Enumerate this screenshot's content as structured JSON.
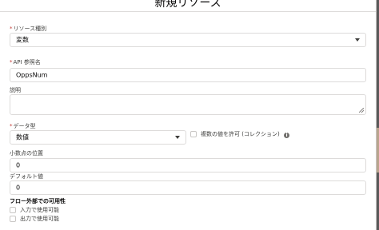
{
  "modal": {
    "title": "新規リソース"
  },
  "fields": {
    "resource_type": {
      "label": "リソース種別",
      "value": "変数"
    },
    "api_name": {
      "label": "API 参照名",
      "value": "OppsNum"
    },
    "description": {
      "label": "説明",
      "value": ""
    },
    "data_type": {
      "label": "データ型",
      "value": "数値"
    },
    "collection": {
      "label": "複数の値を許可 (コレクション)"
    },
    "decimal_places": {
      "label": "小数点の位置",
      "value": "0"
    },
    "default_value": {
      "label": "デフォルト値",
      "value": "0"
    }
  },
  "availability": {
    "heading": "フロー外部での可用性",
    "input_label": "入力で使用可能",
    "output_label": "出力で使用可能"
  },
  "required_marker": "*",
  "colors": {
    "required": "#c23934",
    "border": "#dddbda"
  },
  "icons": {
    "dropdown": "chevron-down-icon",
    "info": "info-icon"
  }
}
